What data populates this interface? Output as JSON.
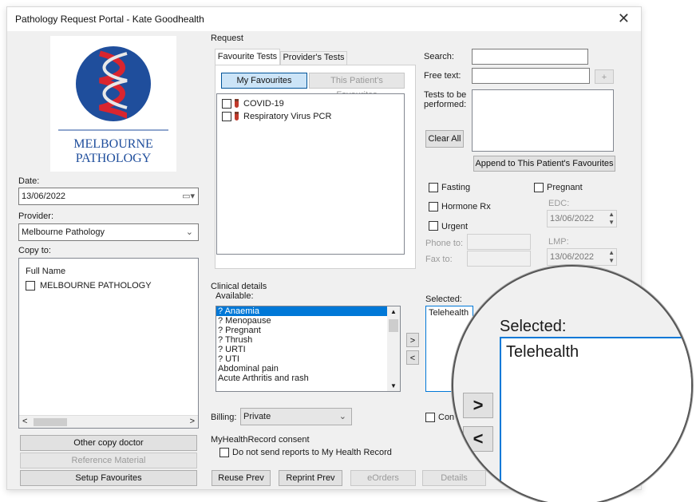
{
  "window": {
    "title": "Pathology Request Portal - Kate Goodhealth",
    "close": "✕"
  },
  "logo": {
    "line1": "MELBOURNE",
    "line2": "PATHOLOGY",
    "colors": {
      "circle": "#1f4e9c",
      "helix": "#d9252f",
      "text": "#1f4e9c"
    }
  },
  "left": {
    "date_label": "Date:",
    "date_value": "13/06/2022",
    "provider_label": "Provider:",
    "provider_value": "Melbourne Pathology",
    "copyto_label": "Copy to:",
    "copyto_header": "Full Name",
    "copyto_items": [
      "MELBOURNE PATHOLOGY"
    ],
    "buttons": {
      "other_copy": "Other copy doctor",
      "reference": "Reference Material",
      "setup": "Setup Favourites"
    }
  },
  "request": {
    "group_label": "Request",
    "tabs": [
      "Favourite Tests",
      "Provider's Tests"
    ],
    "fav_buttons": [
      "My Favourites",
      "This Patient's Favourites"
    ],
    "tests": [
      "COVID-19",
      "Respiratory Virus PCR"
    ],
    "search_label": "Search:",
    "freetext_label": "Free text:",
    "plus": "+",
    "tests_label_1": "Tests to be",
    "tests_label_2": "performed:",
    "clear_all": "Clear All",
    "append": "Append to This Patient's Favourites",
    "fasting": "Fasting",
    "pregnant": "Pregnant",
    "hormone": "Hormone Rx",
    "edc_label": "EDC:",
    "edc_value": "13/06/2022",
    "urgent": "Urgent",
    "phone_label": "Phone to:",
    "lmp_label": "LMP:",
    "fax_label": "Fax to:",
    "lmp_value": "13/06/2022"
  },
  "clinical": {
    "group_label": "Clinical details",
    "available_label": "Available:",
    "available": [
      "? Anaemia",
      "? Menopause",
      "? Pregnant",
      "? Thrush",
      "? URTI",
      "? UTI",
      "Abdominal pain",
      "Acute Arthritis and rash"
    ],
    "selected_label": "Selected:",
    "selected_value": "Telehealth",
    "move_right": ">",
    "move_left": "<"
  },
  "billing": {
    "label": "Billing:",
    "value": "Private"
  },
  "conf_partial": "Con",
  "myhealth": {
    "group_label": "MyHealthRecord consent",
    "checkbox": "Do not send reports to My Health Record"
  },
  "bottom_buttons": {
    "reuse": "Reuse Prev",
    "reprint": "Reprint Prev",
    "eorders": "eOrders",
    "details": "Details"
  },
  "zoom": {
    "selected_label": "Selected:",
    "selected_value": "Telehealth",
    "right": ">",
    "left": "<"
  }
}
